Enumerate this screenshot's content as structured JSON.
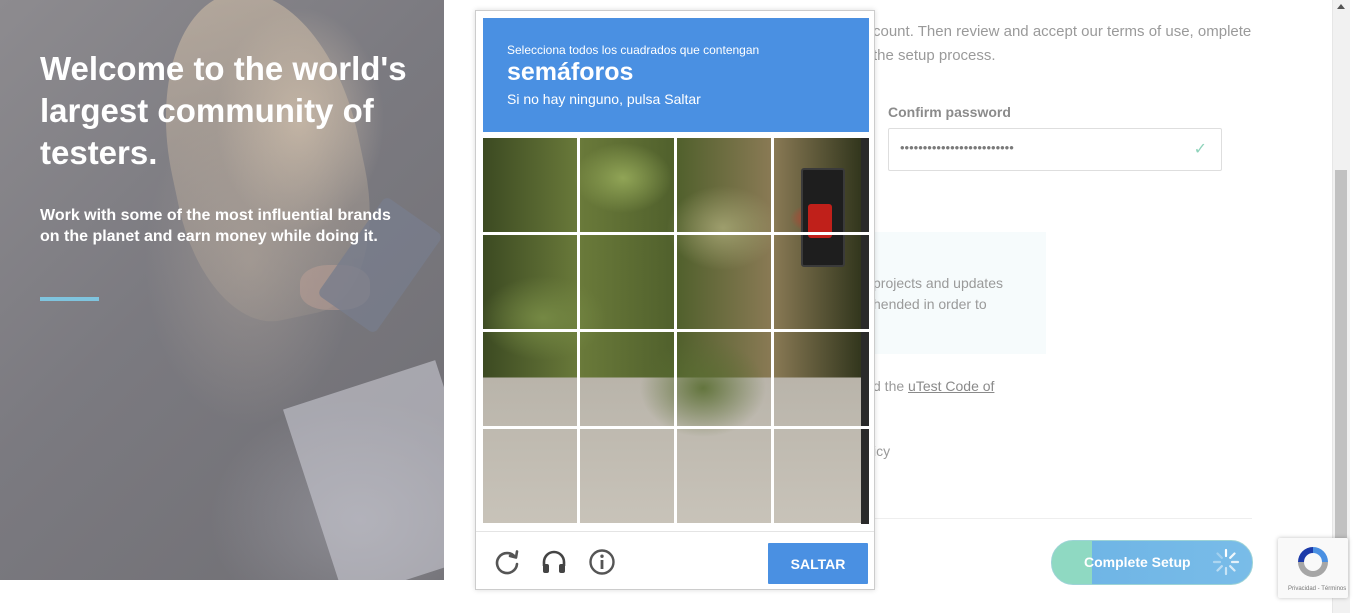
{
  "hero": {
    "title": "Welcome to the world's largest community of testers.",
    "subtitle": "Work with some of the most influential brands on the planet and earn money while doing it."
  },
  "form": {
    "intro": "count. Then review and accept our terms of use, omplete the setup process.",
    "confirm_password_label": "Confirm password",
    "confirm_password_value": "•••••••••••••••••••••••••",
    "notice_line1": "projects and updates",
    "notice_line2": "hended in order to",
    "code_prefix": "d the ",
    "code_link": "uTest Code of",
    "policy_fragment": "icy",
    "complete_button": "Complete Setup"
  },
  "captcha": {
    "instruction": "Selecciona todos los cuadrados que contengan",
    "target": "semáforos",
    "hint": "Si no hay ninguno, pulsa Saltar",
    "skip_label": "SALTAR",
    "icons": [
      "reload-icon",
      "headphones-icon",
      "info-icon"
    ]
  },
  "badge": {
    "text": "Privacidad - Términos"
  },
  "colors": {
    "captcha_blue": "#4a90e2",
    "hero_accent": "#7fc4de",
    "setup_green": "#8fd9c2",
    "setup_blue": "#6fb5e6"
  }
}
